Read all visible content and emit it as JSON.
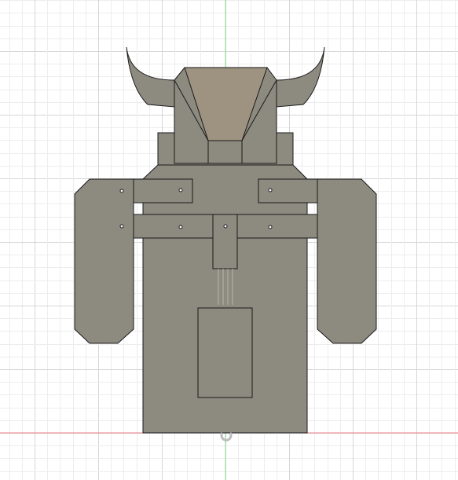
{
  "viewport": {
    "background": "#ffffff",
    "grid_minor_color": "#ededed",
    "grid_major_color": "#d6d6d6",
    "axis_vertical_color": "#8fd88f",
    "axis_horizontal_color": "#ef7d8a"
  },
  "model": {
    "body_fill": "#8d8a80",
    "face_fill": "#9e9380",
    "edge_color": "#1a1a1a",
    "origin_marker_icon": "origin-marker-icon"
  }
}
